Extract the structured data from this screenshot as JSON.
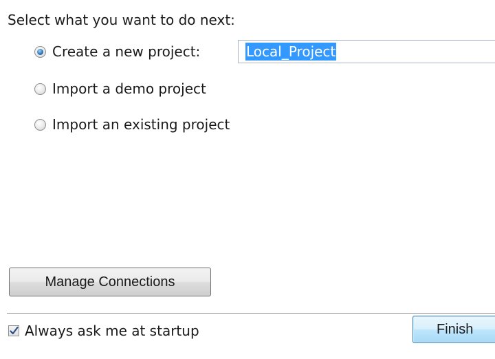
{
  "prompt": "Select what you want to do next:",
  "options": [
    {
      "label": "Create a new project:",
      "checked": true
    },
    {
      "label": "Import a demo project",
      "checked": false
    },
    {
      "label": "Import an existing project",
      "checked": false
    }
  ],
  "project_name": {
    "value": "Local_Project",
    "selected": true
  },
  "buttons": {
    "manage_connections": "Manage Connections",
    "finish": "Finish"
  },
  "startup_checkbox": {
    "label": "Always ask me at startup",
    "checked": true
  },
  "colors": {
    "selection_highlight": "#3399ff",
    "finish_button_border": "#3c7fb1",
    "radio_dot": "#2a6fb3"
  }
}
